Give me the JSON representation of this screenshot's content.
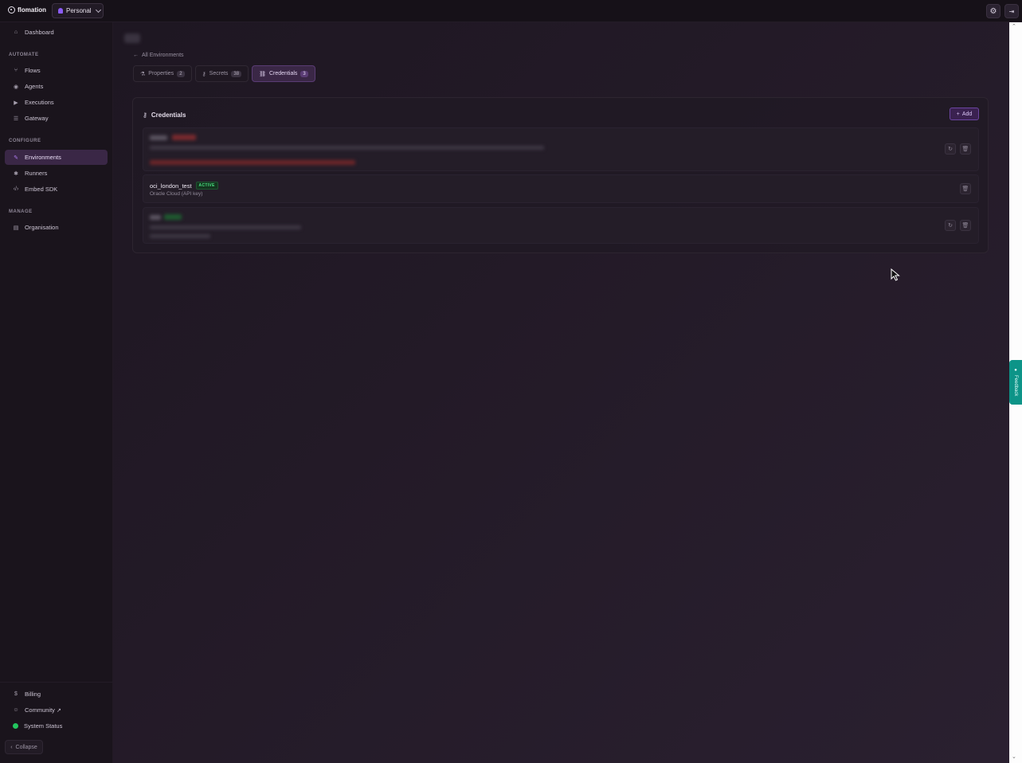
{
  "topbar": {
    "logo_text": "flomation",
    "workspace_label": "Personal"
  },
  "sidebar": {
    "dashboard_label": "Dashboard",
    "sections": {
      "automate": "AUTOMATE",
      "configure": "CONFIGURE",
      "manage": "MANAGE"
    },
    "automate_items": [
      {
        "label": "Flows",
        "icon": "flow-icon"
      },
      {
        "label": "Agents",
        "icon": "agents-icon"
      },
      {
        "label": "Executions",
        "icon": "play-icon"
      },
      {
        "label": "Gateway",
        "icon": "gateway-icon"
      }
    ],
    "configure_items": [
      {
        "label": "Environments",
        "icon": "wrench-icon",
        "active": true
      },
      {
        "label": "Runners",
        "icon": "runner-icon"
      },
      {
        "label": "Embed SDK",
        "icon": "code-icon"
      }
    ],
    "manage_items": [
      {
        "label": "Organisation",
        "icon": "briefcase-icon"
      }
    ],
    "bottom_items": [
      {
        "label": "Billing",
        "icon": "dollar-icon"
      },
      {
        "label": "Community",
        "icon": "discord-icon"
      },
      {
        "label": "System Status",
        "icon": "status-dot-icon"
      }
    ],
    "collapse_label": "Collapse"
  },
  "main": {
    "back_link": "All Environments",
    "tabs": [
      {
        "label": "Properties",
        "count": "2"
      },
      {
        "label": "Secrets",
        "count": "38"
      },
      {
        "label": "Credentials",
        "count": "3",
        "active": true
      }
    ],
    "credentials": {
      "title": "Credentials",
      "add_label": "Add",
      "visible_row": {
        "name": "oci_london_test",
        "status": "ACTIVE",
        "type": "Oracle Cloud (API key)"
      }
    }
  },
  "feedback": {
    "label": "Feedback"
  },
  "colors": {
    "accent": "#8b5cf6",
    "active_nav_bg": "#3a2746",
    "status_green": "#22c55e",
    "feedback_teal": "#0d9488"
  }
}
